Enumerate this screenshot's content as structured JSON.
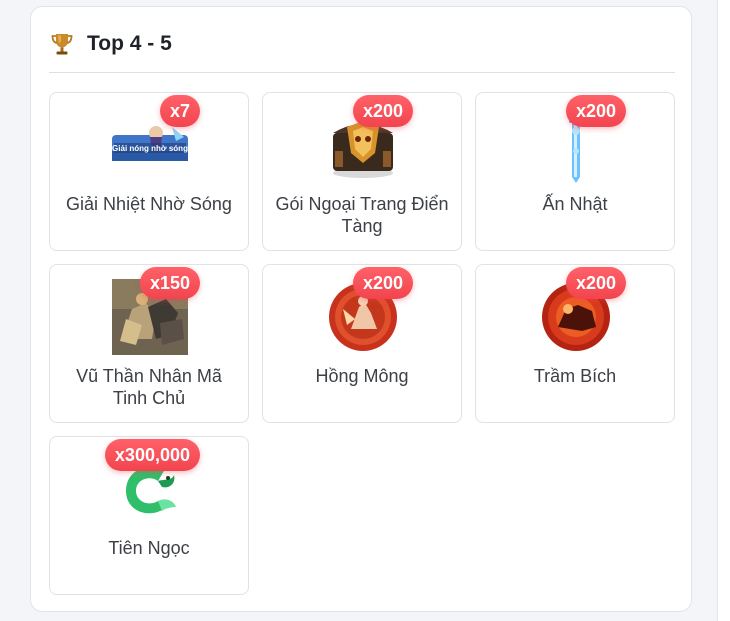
{
  "section": {
    "title": "Top 4 - 5",
    "icon": "trophy-icon"
  },
  "colors": {
    "badge": "#f2444e",
    "title": "#1f2329",
    "item_text": "#3d4046",
    "border": "#dfe2e7"
  },
  "rewards": [
    {
      "name": "Giải Nhiệt Nhờ Sóng",
      "qty": "x7",
      "thumb": "giai-nhiet-nho-song-image",
      "thumb_text": "Giải nóng nhờ sóng"
    },
    {
      "name": "Gói Ngoại Trang Điển Tàng",
      "qty": "x200",
      "thumb": "golden-chest-image"
    },
    {
      "name": "Ấn Nhật",
      "qty": "x200",
      "thumb": "blue-sword-image"
    },
    {
      "name": "Vũ Thần Nhân Mã Tinh Chủ",
      "qty": "x150",
      "thumb": "centaur-warrior-image"
    },
    {
      "name": "Hồng Mông",
      "qty": "x200",
      "thumb": "red-warrior-orb-image"
    },
    {
      "name": "Trầm Bích",
      "qty": "x200",
      "thumb": "red-beast-orb-image"
    },
    {
      "name": "Tiên Ngọc",
      "qty": "x300,000",
      "thumb": "green-jade-image"
    }
  ]
}
